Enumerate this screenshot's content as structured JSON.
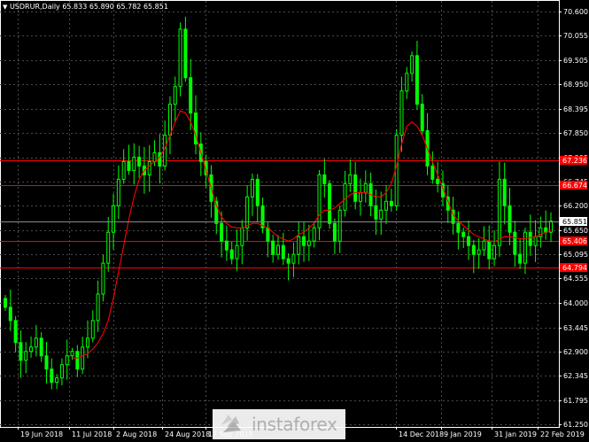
{
  "header": {
    "symbol_line": "USDRUR,Daily  65.833 65.890 65.782 65.851"
  },
  "watermark": {
    "text": "instaforex"
  },
  "colors": {
    "background": "#000000",
    "candles": "#00ff00",
    "moving_average": "#ff0000",
    "support_resistance": "#ff0000",
    "axis_text": "#ffffff",
    "current_price_box": "#ffffff"
  },
  "chart_data": {
    "type": "line",
    "title": "USDRUR,Daily",
    "ohlc_last": {
      "open": 65.833,
      "high": 65.89,
      "low": 65.782,
      "close": 65.851
    },
    "x_tick_labels": [
      "19 Jun 2018",
      "11 Jul 2018",
      "2 Aug 2018",
      "24 Aug 2018",
      "17 Sep 2018",
      "14 Dec 2018",
      "9 Jan 2019",
      "31 Jan 2019",
      "22 Feb 2019"
    ],
    "y_tick_labels": [
      "70.600",
      "70.055",
      "69.505",
      "68.950",
      "68.395",
      "67.850",
      "67.295",
      "66.745",
      "66.200",
      "65.650",
      "65.095",
      "64.555",
      "64.000",
      "63.445",
      "62.900",
      "62.345",
      "61.795",
      "61.250"
    ],
    "ylim": [
      61.25,
      70.6
    ],
    "grid": true,
    "current_price": "65.851",
    "horizontal_levels": [
      {
        "label": "67.236",
        "value": 67.236
      },
      {
        "label": "66.674",
        "value": 66.674
      },
      {
        "label": "65.406",
        "value": 65.406
      },
      {
        "label": "64.794",
        "value": 64.794
      }
    ],
    "series": [
      {
        "values": [
          63.9,
          63.6,
          63.1,
          62.7,
          62.9,
          63.0,
          63.2,
          62.8,
          62.5,
          62.2,
          62.3,
          62.6,
          62.8,
          62.9,
          62.5,
          63.0,
          63.2,
          63.6,
          64.2,
          64.9,
          65.6,
          66.2,
          66.8,
          67.2,
          67.0,
          67.3,
          67.1,
          66.9,
          67.2,
          67.4,
          67.1,
          67.8,
          68.5,
          68.9,
          70.2,
          69.1,
          68.3,
          67.6,
          67.2,
          66.9,
          66.3,
          65.8,
          65.4,
          65.2,
          65.0,
          65.3,
          65.7,
          66.4,
          66.8,
          66.2,
          65.7,
          65.4,
          65.1,
          65.3,
          65.0,
          64.9,
          65.1,
          65.5,
          65.3,
          65.4,
          65.7,
          66.9,
          66.7,
          65.8,
          65.4,
          66.1,
          66.7,
          66.9,
          66.3,
          66.5,
          66.7,
          66.2,
          65.9,
          66.1,
          66.3,
          66.2,
          67.8,
          68.8,
          69.2,
          69.6,
          68.5,
          67.9,
          67.1,
          66.8,
          66.7,
          66.4,
          66.1,
          65.8,
          65.6,
          65.5,
          65.3,
          65.1,
          65.2,
          65.4,
          65.0,
          65.3,
          66.8,
          66.2,
          65.6,
          65.1,
          64.9,
          65.6,
          65.3,
          65.5,
          65.7,
          65.6,
          65.851
        ]
      },
      {
        "name": "",
        "values": [
          null,
          null,
          null,
          null,
          null,
          null,
          null,
          null,
          null,
          null,
          null,
          null,
          null,
          62.75,
          62.75,
          62.8,
          62.85,
          62.95,
          63.1,
          63.3,
          63.6,
          64.1,
          64.7,
          65.3,
          65.9,
          66.4,
          66.8,
          67.0,
          67.1,
          67.2,
          67.3,
          67.5,
          67.8,
          68.1,
          68.35,
          68.3,
          68.1,
          67.8,
          67.4,
          67.0,
          66.6,
          66.2,
          65.95,
          65.8,
          65.72,
          65.7,
          65.7,
          65.75,
          65.8,
          65.8,
          65.75,
          65.7,
          65.6,
          65.5,
          65.45,
          65.4,
          65.45,
          65.55,
          65.6,
          65.7,
          65.8,
          66.0,
          66.1,
          66.1,
          66.15,
          66.25,
          66.35,
          66.45,
          66.5,
          66.5,
          66.5,
          66.45,
          66.4,
          66.4,
          66.5,
          66.7,
          67.1,
          67.6,
          68.0,
          68.1,
          68.0,
          67.8,
          67.5,
          67.2,
          66.9,
          66.6,
          66.3,
          66.0,
          65.85,
          65.75,
          65.65,
          65.55,
          65.5,
          65.45,
          65.4,
          65.38,
          65.45,
          65.5,
          65.5,
          65.48,
          65.45,
          65.45,
          65.48,
          65.5,
          65.55,
          65.6,
          65.65
        ]
      }
    ]
  }
}
